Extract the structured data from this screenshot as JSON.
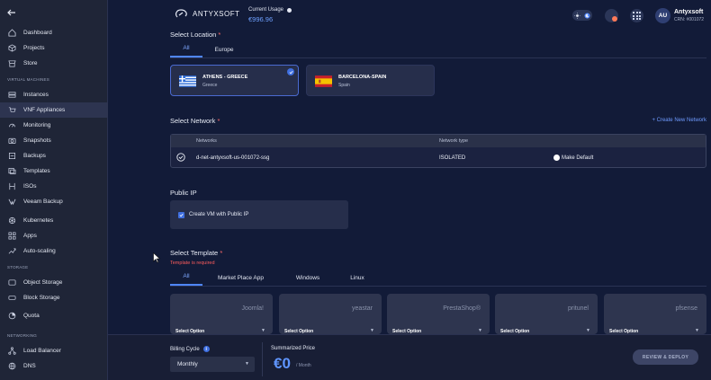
{
  "sidebar": {
    "items": [
      {
        "label": "Dashboard",
        "icon": "home-icon"
      },
      {
        "label": "Projects",
        "icon": "cube-icon"
      },
      {
        "label": "Store",
        "icon": "store-icon"
      }
    ],
    "section_vm": "VIRTUAL MACHINES",
    "vm_items": [
      {
        "label": "Instances",
        "icon": "server-icon"
      },
      {
        "label": "VNF Appliances",
        "icon": "cart-icon"
      },
      {
        "label": "Monitoring",
        "icon": "gauge-icon"
      },
      {
        "label": "Snapshots",
        "icon": "snapshot-icon"
      },
      {
        "label": "Backups",
        "icon": "backup-icon"
      },
      {
        "label": "Templates",
        "icon": "template-icon"
      },
      {
        "label": "ISOs",
        "icon": "iso-icon"
      },
      {
        "label": "Veeam Backup",
        "icon": "veeam-icon"
      },
      {
        "label": "Kubernetes",
        "icon": "kubernetes-icon"
      },
      {
        "label": "Apps",
        "icon": "apps-icon"
      },
      {
        "label": "Auto-scaling",
        "icon": "autoscale-icon"
      }
    ],
    "section_storage": "STORAGE",
    "storage_items": [
      {
        "label": "Object Storage",
        "icon": "bucket-icon"
      },
      {
        "label": "Block Storage",
        "icon": "disk-icon"
      },
      {
        "label": "Quota",
        "icon": "quota-icon"
      }
    ],
    "section_networking": "NETWORKING",
    "net_items": [
      {
        "label": "Load Balancer",
        "icon": "loadbalancer-icon"
      },
      {
        "label": "DNS",
        "icon": "globe-icon"
      }
    ]
  },
  "header": {
    "brand": "ANTYXSOFT",
    "usage_label": "Current Usage",
    "usage_value": "€996.96",
    "avatar_initials": "AU",
    "user_name": "Antyxsoft",
    "user_crn": "CRN: #001072"
  },
  "location": {
    "title": "Select Location",
    "required": "*",
    "tabs": [
      "All",
      "Europe"
    ],
    "cards": [
      {
        "name": "ATHENS - GREECE",
        "country": "Greece",
        "selected": true
      },
      {
        "name": "BARCELONA-SPAIN",
        "country": "Spain",
        "selected": false
      }
    ]
  },
  "network": {
    "title": "Select Network",
    "required": "*",
    "create_link": "+ Create New Network",
    "col_networks": "Networks",
    "col_type": "Network type",
    "row_name": "d-net-antyxsoft-us-001072-ssg",
    "row_type": "ISOLATED",
    "row_default": "Make Default"
  },
  "public_ip": {
    "title": "Public IP",
    "checkbox_label": "Create VM with Public IP",
    "checked": true
  },
  "template": {
    "title": "Select Template",
    "required": "*",
    "error": "Template is required",
    "tabs": [
      "All",
      "Market Place App",
      "Windows",
      "Linux"
    ],
    "cards": [
      {
        "name": "Joomla!",
        "select": "Select Option"
      },
      {
        "name": "yeastar",
        "select": "Select Option"
      },
      {
        "name": "PrestaShop®",
        "select": "Select Option"
      },
      {
        "name": "pritunel",
        "select": "Select Option"
      },
      {
        "name": "pfsense",
        "select": "Select Option"
      }
    ]
  },
  "footer": {
    "billing_label": "Billing Cycle",
    "billing_value": "Monthly",
    "summary_label": "Summarized Price",
    "summary_price": "€0",
    "summary_period": "/ Month",
    "review_button": "REVIEW & DEPLOY"
  },
  "colors": {
    "accent": "#4f86ff",
    "price": "#5f95ff",
    "required": "#ff5d5d"
  }
}
